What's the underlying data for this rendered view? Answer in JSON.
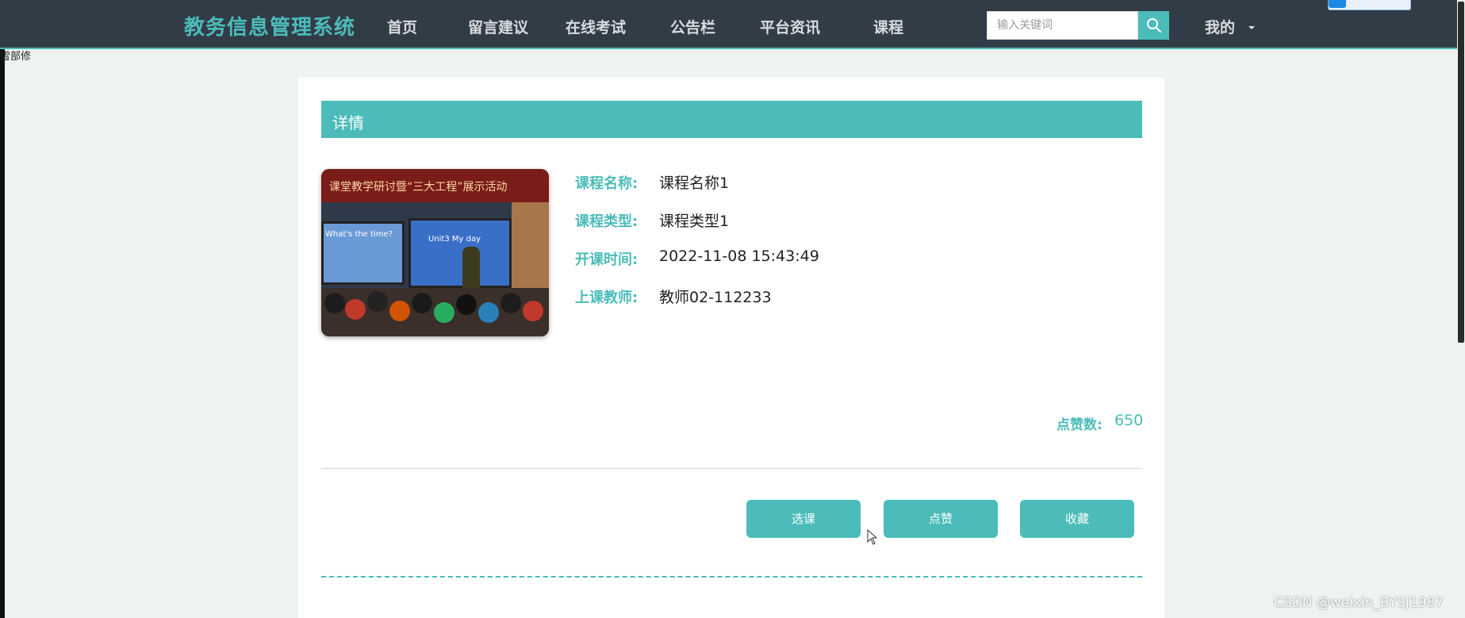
{
  "header": {
    "brand": "教务信息管理系统",
    "nav": [
      "首页",
      "留言建议",
      "在线考试",
      "公告栏",
      "平台资讯",
      "课程"
    ],
    "search_placeholder": "输入关键词",
    "user_menu": "我的"
  },
  "edge_text": "雪部修",
  "detail": {
    "title": "详情",
    "image_banner": "课堂教学研讨暨“三大工程”展示活动",
    "image_screen1": "What's the time?",
    "image_screen2": "Unit3 My day",
    "fields": [
      {
        "label": "课程名称:",
        "value": "课程名称1"
      },
      {
        "label": "课程类型:",
        "value": "课程类型1"
      },
      {
        "label": "开课时间:",
        "value": "2022-11-08 15:43:49"
      },
      {
        "label": "上课教师:",
        "value": "教师02-112233"
      }
    ],
    "likes_label": "点赞数:",
    "likes_value": "650",
    "buttons": [
      "选课",
      "点赞",
      "收藏"
    ]
  },
  "watermark": "CSDN @weixin_BYSJ1987",
  "colors": {
    "accent": "#4bbcb9",
    "header_bg": "#323c47",
    "page_bg": "#eef3f2"
  }
}
